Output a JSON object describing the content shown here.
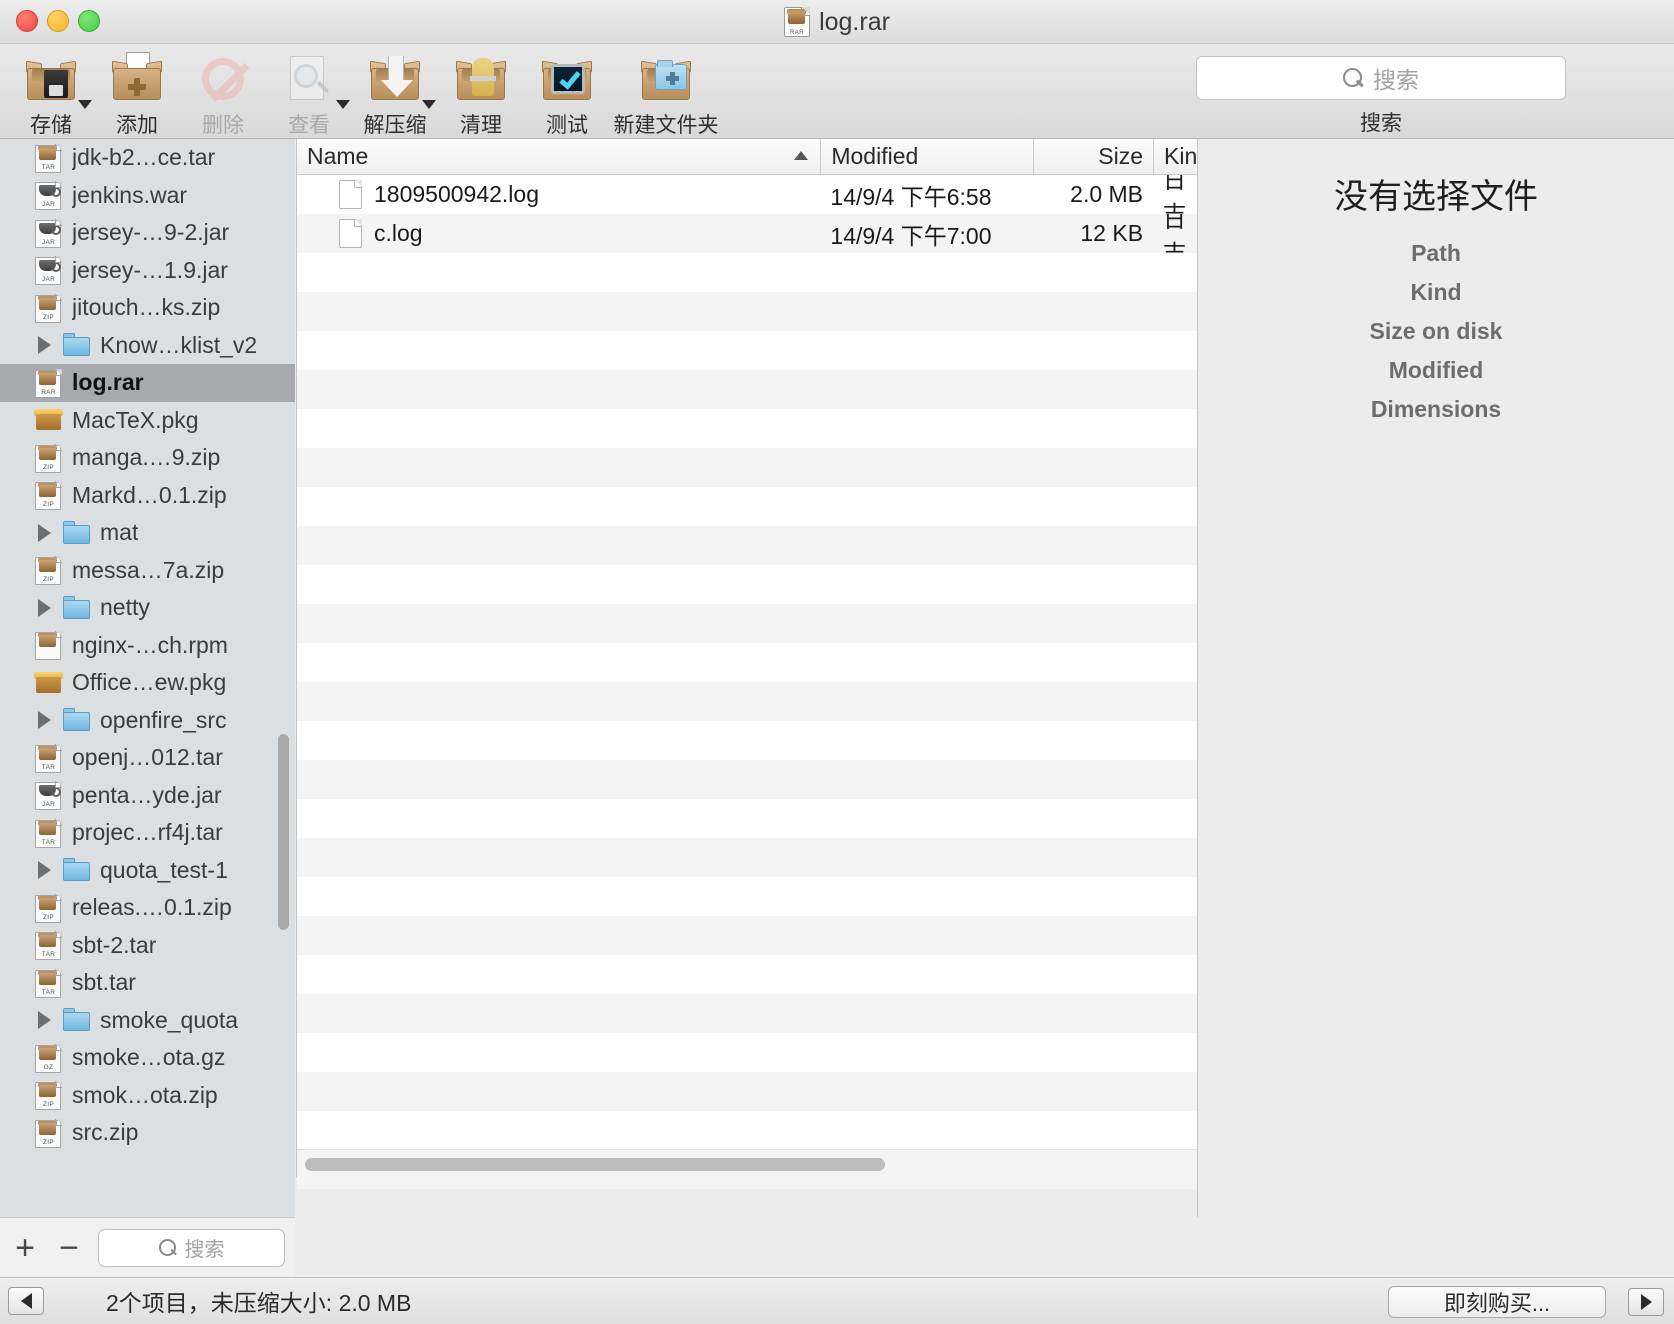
{
  "window": {
    "title": "log.rar",
    "title_icon": "rar-archive-icon"
  },
  "toolbar": {
    "buttons": [
      {
        "label": "存储",
        "icon": "save-box-icon",
        "disabled": false,
        "caret": true
      },
      {
        "label": "添加",
        "icon": "add-box-icon",
        "disabled": false,
        "caret": false
      },
      {
        "label": "删除",
        "icon": "delete-prohibit-icon",
        "disabled": true,
        "caret": false
      },
      {
        "label": "查看",
        "icon": "view-magnifier-icon",
        "disabled": true,
        "caret": true
      },
      {
        "label": "解压缩",
        "icon": "extract-box-icon",
        "disabled": false,
        "caret": true
      },
      {
        "label": "清理",
        "icon": "clean-broom-icon",
        "disabled": false,
        "caret": false
      },
      {
        "label": "测试",
        "icon": "test-screen-icon",
        "disabled": false,
        "caret": false
      },
      {
        "label": "新建文件夹",
        "icon": "new-folder-icon",
        "disabled": false,
        "caret": false
      }
    ],
    "search": {
      "placeholder": "搜索",
      "label": "搜索",
      "icon": "search-icon"
    }
  },
  "sidebar": {
    "items": [
      {
        "name": "jdk-b2…ce.tar",
        "icon": "tar-archive-icon",
        "badge": "TAR",
        "type": "archive",
        "expandable": false,
        "selected": false
      },
      {
        "name": "jenkins.war",
        "icon": "jar-archive-icon",
        "badge": "JAR",
        "type": "jar",
        "expandable": false,
        "selected": false
      },
      {
        "name": "jersey-…9-2.jar",
        "icon": "jar-archive-icon",
        "badge": "JAR",
        "type": "jar",
        "expandable": false,
        "selected": false
      },
      {
        "name": "jersey-…1.9.jar",
        "icon": "jar-archive-icon",
        "badge": "JAR",
        "type": "jar",
        "expandable": false,
        "selected": false
      },
      {
        "name": "jitouch…ks.zip",
        "icon": "zip-archive-icon",
        "badge": "ZIP",
        "type": "archive",
        "expandable": false,
        "selected": false
      },
      {
        "name": "Know…klist_v2",
        "icon": "folder-icon",
        "badge": "",
        "type": "folder",
        "expandable": true,
        "selected": false
      },
      {
        "name": "log.rar",
        "icon": "rar-archive-icon",
        "badge": "RAR",
        "type": "archive",
        "expandable": false,
        "selected": true
      },
      {
        "name": "MacTeX.pkg",
        "icon": "pkg-icon",
        "badge": "",
        "type": "pkg",
        "expandable": false,
        "selected": false
      },
      {
        "name": "manga.…9.zip",
        "icon": "zip-archive-icon",
        "badge": "ZIP",
        "type": "archive",
        "expandable": false,
        "selected": false
      },
      {
        "name": "Markd…0.1.zip",
        "icon": "zip-archive-icon",
        "badge": "ZIP",
        "type": "archive",
        "expandable": false,
        "selected": false
      },
      {
        "name": "mat",
        "icon": "folder-icon",
        "badge": "",
        "type": "folder",
        "expandable": true,
        "selected": false
      },
      {
        "name": "messa…7a.zip",
        "icon": "zip-archive-icon",
        "badge": "ZIP",
        "type": "archive",
        "expandable": false,
        "selected": false
      },
      {
        "name": "netty",
        "icon": "folder-icon",
        "badge": "",
        "type": "folder",
        "expandable": true,
        "selected": false
      },
      {
        "name": "nginx-…ch.rpm",
        "icon": "rpm-archive-icon",
        "badge": "",
        "type": "archive",
        "expandable": false,
        "selected": false
      },
      {
        "name": "Office…ew.pkg",
        "icon": "pkg-icon",
        "badge": "",
        "type": "pkg",
        "expandable": false,
        "selected": false
      },
      {
        "name": "openfire_src",
        "icon": "folder-icon",
        "badge": "",
        "type": "folder",
        "expandable": true,
        "selected": false
      },
      {
        "name": "openj…012.tar",
        "icon": "tar-archive-icon",
        "badge": "TAR",
        "type": "archive",
        "expandable": false,
        "selected": false
      },
      {
        "name": "penta…yde.jar",
        "icon": "jar-archive-icon",
        "badge": "JAR",
        "type": "jar",
        "expandable": false,
        "selected": false
      },
      {
        "name": "projec…rf4j.tar",
        "icon": "tar-archive-icon",
        "badge": "TAR",
        "type": "archive",
        "expandable": false,
        "selected": false
      },
      {
        "name": "quota_test-1",
        "icon": "folder-icon",
        "badge": "",
        "type": "folder",
        "expandable": true,
        "selected": false
      },
      {
        "name": "releas.…0.1.zip",
        "icon": "zip-archive-icon",
        "badge": "ZIP",
        "type": "archive",
        "expandable": false,
        "selected": false
      },
      {
        "name": "sbt-2.tar",
        "icon": "tar-archive-icon",
        "badge": "TAR",
        "type": "archive",
        "expandable": false,
        "selected": false
      },
      {
        "name": "sbt.tar",
        "icon": "tar-archive-icon",
        "badge": "TAR",
        "type": "archive",
        "expandable": false,
        "selected": false
      },
      {
        "name": "smoke_quota",
        "icon": "folder-icon",
        "badge": "",
        "type": "folder",
        "expandable": true,
        "selected": false
      },
      {
        "name": "smoke…ota.gz",
        "icon": "gz-archive-icon",
        "badge": "GZ",
        "type": "archive",
        "expandable": false,
        "selected": false
      },
      {
        "name": "smok…ota.zip",
        "icon": "zip-archive-icon",
        "badge": "ZIP",
        "type": "archive",
        "expandable": false,
        "selected": false
      },
      {
        "name": "src.zip",
        "icon": "zip-archive-icon",
        "badge": "ZIP",
        "type": "archive",
        "expandable": false,
        "selected": false
      }
    ],
    "footer": {
      "add_label": "+",
      "remove_label": "−",
      "search_placeholder": "搜索",
      "search_icon": "search-icon"
    }
  },
  "filelist": {
    "columns": [
      {
        "key": "name",
        "label": "Name",
        "sorted": true
      },
      {
        "key": "modified",
        "label": "Modified",
        "sorted": false
      },
      {
        "key": "size",
        "label": "Size",
        "sorted": false
      },
      {
        "key": "kind",
        "label": "Kind",
        "sorted": false
      }
    ],
    "rows": [
      {
        "name": "1809500942.log",
        "modified": "14/9/4 下午6:58",
        "size": "2.0 MB",
        "kind": "日志",
        "icon": "document-icon"
      },
      {
        "name": "c.log",
        "modified": "14/9/4 下午7:00",
        "size": "12 KB",
        "kind": "日志",
        "icon": "document-icon"
      }
    ]
  },
  "infopanel": {
    "title": "没有选择文件",
    "fields": [
      {
        "label": "Path"
      },
      {
        "label": "Kind"
      },
      {
        "label": "Size on disk"
      },
      {
        "label": "Modified"
      },
      {
        "label": "Dimensions"
      }
    ]
  },
  "statusbar": {
    "text": "2个项目，未压缩大小: 2.0 MB",
    "buy_label": "即刻购买...",
    "left_toggle_icon": "sidebar-collapse-left-icon",
    "right_toggle_icon": "panel-collapse-right-icon"
  },
  "colors": {
    "selection": "#a8a9ae",
    "folder": "#8cc4e4",
    "row_alt": "#f4f4f4"
  }
}
